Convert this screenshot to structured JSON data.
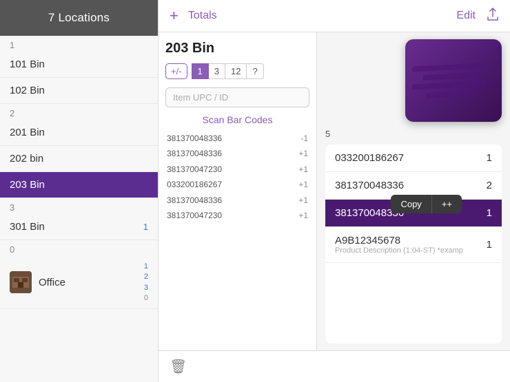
{
  "sidebar": {
    "header": "7 Locations",
    "sections": [
      {
        "label": "1",
        "items": [
          {
            "id": "101-bin",
            "name": "101 Bin",
            "active": false
          },
          {
            "id": "102-bin",
            "name": "102 Bin",
            "active": false
          }
        ]
      },
      {
        "label": "2",
        "items": [
          {
            "id": "201-bin",
            "name": "201 Bin",
            "active": false
          },
          {
            "id": "202-bin",
            "name": "202 bin",
            "active": false
          },
          {
            "id": "203-bin",
            "name": "203 Bin",
            "active": true
          }
        ]
      },
      {
        "label": "3",
        "items": [
          {
            "id": "301-bin",
            "name": "301 Bin",
            "active": false,
            "badge": "1"
          }
        ]
      },
      {
        "label": "0",
        "items": []
      }
    ],
    "office": {
      "label": "Office",
      "badges": [
        "1",
        "2",
        "3",
        "0"
      ]
    }
  },
  "toolbar": {
    "add_label": "+",
    "totals_label": "Totals",
    "edit_label": "Edit",
    "share_icon": "↑"
  },
  "main": {
    "bin_title": "203 Bin",
    "tabs": {
      "toggle": "+/-",
      "numbers": [
        "1",
        "3",
        "12",
        "?"
      ],
      "active_index": 0
    },
    "search_placeholder": "Item UPC / ID",
    "scan_codes_label": "Scan Bar Codes",
    "scan_list": [
      {
        "code": "381370048336",
        "delta": "-1"
      },
      {
        "code": "381370048336",
        "delta": "+1"
      },
      {
        "code": "381370047230",
        "delta": "+1"
      },
      {
        "code": "033200186267",
        "delta": "+1"
      },
      {
        "code": "381370048336",
        "delta": "+1"
      },
      {
        "code": "381370047230",
        "delta": "+1"
      }
    ],
    "count_label": "5",
    "items": [
      {
        "code": "033200186267",
        "qty": "1",
        "desc": "",
        "highlighted": false
      },
      {
        "code": "381370048336",
        "qty": "2",
        "desc": "",
        "highlighted": false
      },
      {
        "code": "381370048336",
        "qty": "1",
        "desc": "",
        "highlighted": true
      },
      {
        "code": "A9B12345678",
        "qty": "1",
        "desc": "Product Description (1:04-ST) *examp",
        "highlighted": false
      }
    ],
    "copy_btn": "Copy",
    "pp_btn": "++"
  },
  "bottom": {
    "trash_icon": "🗑"
  }
}
